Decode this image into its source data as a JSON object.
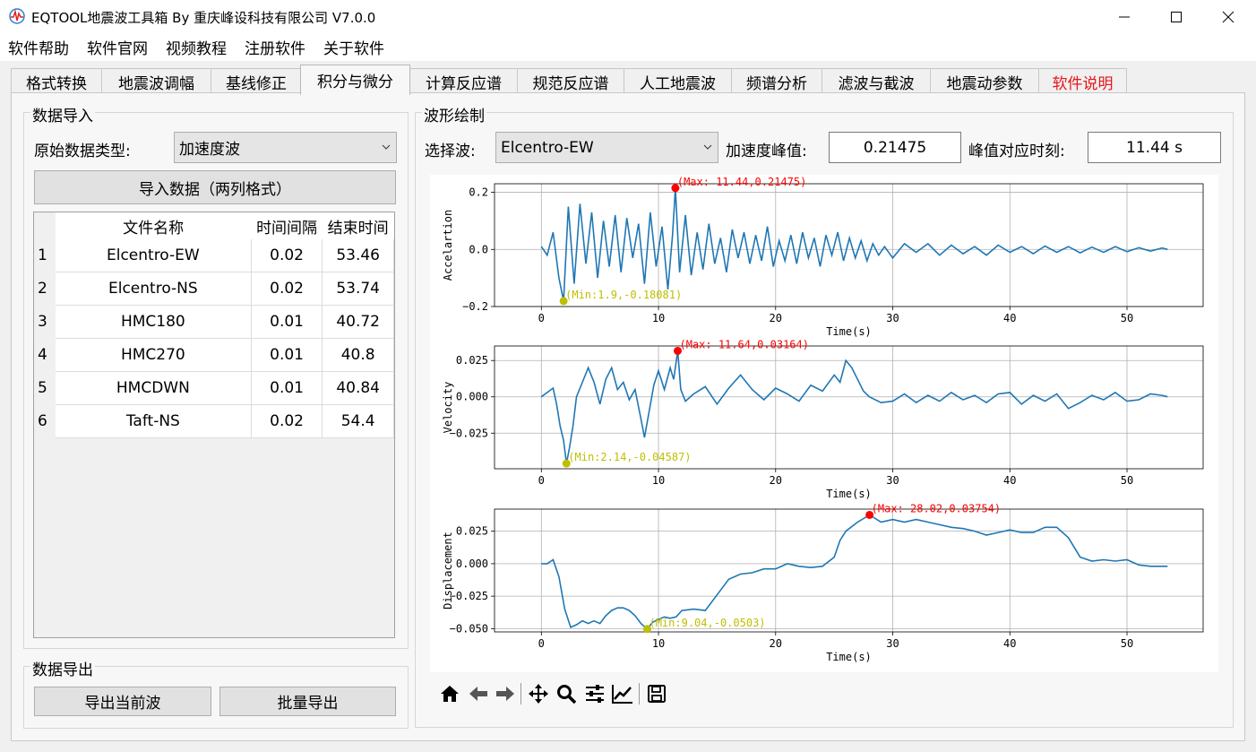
{
  "window": {
    "title": "EQTOOL地震波工具箱 By 重庆峰设科技有限公司  V7.0.0",
    "icon": "seismograph-icon",
    "controls": [
      "minimize-icon",
      "maximize-icon",
      "close-icon"
    ]
  },
  "menu": [
    "软件帮助",
    "软件官网",
    "视频教程",
    "注册软件",
    "关于软件"
  ],
  "tabs": [
    {
      "label": "格式转换"
    },
    {
      "label": "地震波调幅"
    },
    {
      "label": "基线修正"
    },
    {
      "label": "积分与微分",
      "active": true
    },
    {
      "label": "计算反应谱"
    },
    {
      "label": "规范反应谱"
    },
    {
      "label": "人工地震波"
    },
    {
      "label": "频谱分析"
    },
    {
      "label": "滤波与截波"
    },
    {
      "label": "地震动参数"
    },
    {
      "label": "软件说明",
      "color": "#e8141b"
    }
  ],
  "import_group": {
    "title": "数据导入",
    "type_label": "原始数据类型:",
    "type_value": "加速度波",
    "import_button": "导入数据（两列格式）",
    "table": {
      "headers": [
        "文件名称",
        "时间间隔",
        "结束时间"
      ],
      "rows": [
        {
          "index": "1",
          "name": "Elcentro-EW",
          "dt": "0.02",
          "end": "53.46"
        },
        {
          "index": "2",
          "name": "Elcentro-NS",
          "dt": "0.02",
          "end": "53.74"
        },
        {
          "index": "3",
          "name": "HMC180",
          "dt": "0.01",
          "end": "40.72"
        },
        {
          "index": "4",
          "name": "HMC270",
          "dt": "0.01",
          "end": "40.8"
        },
        {
          "index": "5",
          "name": "HMCDWN",
          "dt": "0.01",
          "end": "40.84"
        },
        {
          "index": "6",
          "name": "Taft-NS",
          "dt": "0.02",
          "end": "54.4"
        }
      ]
    }
  },
  "export_group": {
    "title": "数据导出",
    "export_current": "导出当前波",
    "batch_export": "批量导出"
  },
  "wave_group": {
    "title": "波形绘制",
    "select_label": "选择波:",
    "select_value": "Elcentro-EW",
    "peak_label": "加速度峰值:",
    "peak_value": "0.21475",
    "peak_time_label": "峰值对应时刻:",
    "peak_time_value": "11.44 s"
  },
  "chart_data": [
    {
      "type": "line",
      "ylabel": "Accelartion",
      "xlabel": "Time(s)",
      "xlim": [
        -4,
        56.5
      ],
      "ylim": [
        -0.2,
        0.23
      ],
      "xticks": [
        0,
        10,
        20,
        30,
        40,
        50
      ],
      "yticks": [
        -0.2,
        0.0,
        0.2
      ],
      "ytick_labels": [
        "−0.2",
        "0.0",
        "0.2"
      ],
      "grid": true,
      "line_color": "#1f77b4",
      "max_annotation": {
        "x": 11.44,
        "y": 0.21475,
        "label": "(Max: 11.44,0.21475)",
        "color": "#ff0000"
      },
      "min_annotation": {
        "x": 1.9,
        "y": -0.18081,
        "label": "(Min:1.9,-0.18081)",
        "color": "#bfbf00"
      },
      "series": [
        {
          "x": [
            0,
            0.5,
            1,
            1.5,
            1.9,
            2.3,
            2.8,
            3.3,
            3.8,
            4.3,
            4.8,
            5.3,
            5.8,
            6.3,
            6.8,
            7.3,
            7.8,
            8.3,
            8.8,
            9.3,
            9.8,
            10.3,
            10.8,
            11.2,
            11.44,
            11.8,
            12.3,
            12.8,
            13.3,
            13.8,
            14.3,
            14.8,
            15.3,
            15.8,
            16.3,
            16.8,
            17.3,
            17.8,
            18.3,
            18.8,
            19.3,
            19.8,
            20.3,
            20.8,
            21.3,
            21.8,
            22.3,
            22.8,
            23.3,
            23.8,
            24.3,
            24.8,
            25.3,
            25.8,
            26.3,
            26.8,
            27.3,
            27.8,
            28.3,
            28.8,
            29.3,
            30,
            31,
            32,
            33,
            34,
            35,
            36,
            37,
            38,
            39,
            40,
            41,
            42,
            43,
            44,
            45,
            46,
            47,
            48,
            49,
            50,
            51,
            52,
            53,
            53.46
          ],
          "y": [
            0.01,
            -0.02,
            0.06,
            -0.1,
            -0.18,
            0.15,
            -0.12,
            0.16,
            -0.05,
            0.13,
            -0.1,
            0.1,
            -0.06,
            0.12,
            -0.08,
            0.11,
            -0.03,
            0.09,
            -0.12,
            0.13,
            -0.06,
            0.08,
            -0.14,
            0.05,
            0.21475,
            -0.08,
            0.12,
            -0.09,
            0.06,
            -0.07,
            0.09,
            -0.05,
            0.04,
            -0.08,
            0.07,
            -0.03,
            0.06,
            -0.05,
            0.05,
            -0.04,
            0.08,
            -0.06,
            0.03,
            -0.04,
            0.05,
            -0.05,
            0.06,
            -0.03,
            0.04,
            -0.06,
            0.05,
            -0.02,
            0.06,
            -0.04,
            0.04,
            -0.03,
            0.03,
            -0.04,
            0.02,
            -0.02,
            0.01,
            -0.03,
            0.02,
            -0.01,
            0.02,
            -0.02,
            0.015,
            -0.015,
            0.01,
            -0.02,
            0.015,
            -0.01,
            0.01,
            -0.015,
            0.012,
            -0.01,
            0.01,
            -0.012,
            0.008,
            -0.01,
            0.01,
            -0.008,
            0.006,
            -0.006,
            0.005,
            0.0
          ]
        }
      ]
    },
    {
      "type": "line",
      "ylabel": "Velocity",
      "xlabel": "Time(s)",
      "xlim": [
        -4,
        56.5
      ],
      "ylim": [
        -0.0495,
        0.035
      ],
      "xticks": [
        0,
        10,
        20,
        30,
        40,
        50
      ],
      "yticks": [
        -0.025,
        0.0,
        0.025
      ],
      "ytick_labels": [
        "−0.025",
        "0.000",
        "0.025"
      ],
      "grid": true,
      "line_color": "#1f77b4",
      "max_annotation": {
        "x": 11.64,
        "y": 0.03164,
        "label": "(Max: 11.64,0.03164)",
        "color": "#ff0000"
      },
      "min_annotation": {
        "x": 2.14,
        "y": -0.04587,
        "label": "(Min:2.14,-0.04587)",
        "color": "#bfbf00"
      },
      "series": [
        {
          "x": [
            0,
            0.5,
            1,
            1.3,
            1.6,
            1.9,
            2.14,
            2.4,
            2.7,
            3,
            3.5,
            4,
            4.5,
            5,
            5.5,
            6,
            6.5,
            7,
            7.5,
            8,
            8.5,
            8.8,
            9.2,
            9.6,
            10,
            10.5,
            11,
            11.3,
            11.64,
            11.9,
            12.3,
            13,
            14,
            15,
            16,
            17,
            18,
            19,
            20,
            21,
            22,
            23,
            24,
            25,
            25.5,
            26,
            26.5,
            27,
            27.5,
            28,
            29,
            30,
            31,
            32,
            33,
            34,
            35,
            36,
            37,
            38,
            39,
            40,
            41,
            42,
            43,
            44,
            45,
            46,
            47,
            48,
            49,
            50,
            51,
            52,
            53,
            53.46
          ],
          "y": [
            0,
            0.003,
            0.006,
            -0.005,
            -0.02,
            -0.03,
            -0.04587,
            -0.035,
            -0.02,
            0.0,
            0.01,
            0.02,
            0.01,
            -0.005,
            0.012,
            0.02,
            0.005,
            0.01,
            -0.002,
            0.005,
            -0.015,
            -0.028,
            -0.01,
            0.008,
            0.018,
            0.005,
            0.02,
            0.012,
            0.03164,
            0.005,
            -0.003,
            0.002,
            0.007,
            -0.005,
            0.006,
            0.015,
            0.005,
            -0.002,
            0.006,
            0.002,
            -0.003,
            0.008,
            0.004,
            0.015,
            0.01,
            0.025,
            0.02,
            0.012,
            0.004,
            0.0,
            -0.004,
            -0.003,
            0.002,
            -0.004,
            0.001,
            -0.003,
            0.003,
            -0.002,
            0.001,
            -0.004,
            0.002,
            0.003,
            -0.005,
            0.001,
            -0.003,
            0.002,
            -0.008,
            -0.004,
            0.001,
            -0.002,
            0.003,
            -0.003,
            -0.002,
            0.002,
            0.001,
            0.0
          ]
        }
      ]
    },
    {
      "type": "line",
      "ylabel": "Displacement",
      "xlabel": "Time(s)",
      "xlim": [
        -4,
        56.5
      ],
      "ylim": [
        -0.0525,
        0.042
      ],
      "xticks": [
        0,
        10,
        20,
        30,
        40,
        50
      ],
      "yticks": [
        -0.05,
        -0.025,
        0.0,
        0.025
      ],
      "ytick_labels": [
        "−0.050",
        "−0.025",
        "0.000",
        "0.025"
      ],
      "grid": true,
      "line_color": "#1f77b4",
      "max_annotation": {
        "x": 28.02,
        "y": 0.03754,
        "label": "(Max: 28.02,0.03754)",
        "color": "#ff0000"
      },
      "min_annotation": {
        "x": 9.04,
        "y": -0.0503,
        "label": "(Min:9.04,-0.0503)",
        "color": "#bfbf00"
      },
      "series": [
        {
          "x": [
            0,
            0.5,
            1,
            1.5,
            2,
            2.5,
            3,
            3.5,
            4,
            4.5,
            5,
            5.5,
            6,
            6.5,
            7,
            7.5,
            8,
            8.5,
            9.04,
            9.5,
            10,
            10.5,
            11,
            11.5,
            12,
            13,
            14,
            15,
            16,
            17,
            18,
            19,
            20,
            21,
            22,
            23,
            24,
            25,
            25.5,
            26,
            27,
            28.02,
            29,
            30,
            31,
            32,
            33,
            34,
            35,
            36,
            37,
            38,
            39,
            40,
            41,
            42,
            43,
            44,
            45,
            46,
            47,
            48,
            49,
            50,
            51,
            52,
            53,
            53.46
          ],
          "y": [
            0,
            0,
            0.003,
            -0.01,
            -0.035,
            -0.049,
            -0.047,
            -0.044,
            -0.046,
            -0.044,
            -0.046,
            -0.04,
            -0.036,
            -0.034,
            -0.034,
            -0.036,
            -0.04,
            -0.046,
            -0.0503,
            -0.045,
            -0.043,
            -0.041,
            -0.042,
            -0.041,
            -0.036,
            -0.035,
            -0.036,
            -0.024,
            -0.012,
            -0.008,
            -0.007,
            -0.004,
            -0.004,
            0.0,
            -0.002,
            -0.003,
            -0.002,
            0.005,
            0.018,
            0.025,
            0.032,
            0.03754,
            0.032,
            0.034,
            0.032,
            0.034,
            0.032,
            0.03,
            0.028,
            0.027,
            0.025,
            0.022,
            0.024,
            0.026,
            0.024,
            0.024,
            0.028,
            0.028,
            0.02,
            0.005,
            0.002,
            0.003,
            0.002,
            0.003,
            -0.001,
            -0.002,
            -0.002,
            -0.002
          ]
        }
      ]
    }
  ],
  "plot_toolbar": [
    "home-icon",
    "back-icon",
    "forward-icon",
    "pan-icon",
    "zoom-icon",
    "configure-subplots-icon",
    "edit-axis-icon",
    "save-icon"
  ]
}
